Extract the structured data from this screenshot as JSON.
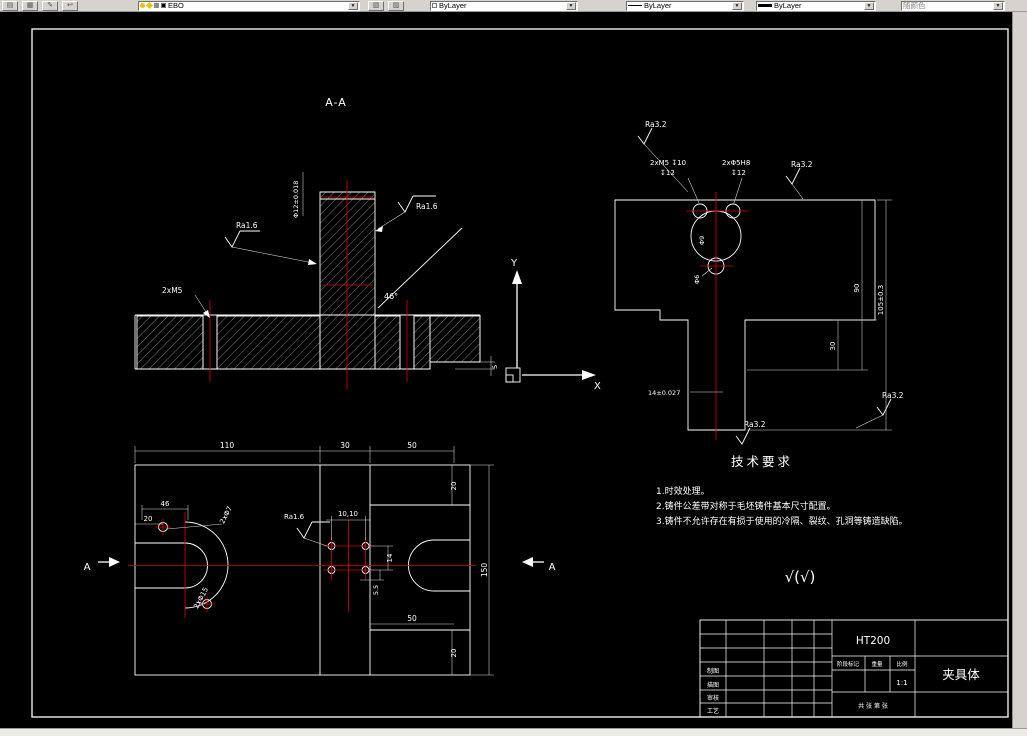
{
  "toolbar": {
    "layer": {
      "value": "EBO"
    },
    "color": {
      "value": "ByLayer"
    },
    "linetype": {
      "value": "ByLayer"
    },
    "lineweight": {
      "value": "ByLayer"
    },
    "plot_style": {
      "value": "随颜色"
    }
  },
  "palette": {
    "canvas_bg": "#000000",
    "drawing_line": "#ffffff",
    "centerline": "#dd0000",
    "toolbar_bg": "#d6d3ce"
  },
  "ucs": {
    "x": "X",
    "y": "Y"
  },
  "section_view": {
    "title": "A-A",
    "ra_right": "Ra1.6",
    "ra_left": "Ra1.6",
    "thread_label": "2xM5",
    "bore_label": "Φ12±0.018",
    "angle_label": "46°",
    "step_label": "5"
  },
  "right_view": {
    "ra_top": "Ra3.2",
    "ra_upper": "Ra3.2",
    "ra_lower_right": "Ra3.2",
    "ra_bottom": "Ra3.2",
    "thread_note_1": "2xM5 ↧10",
    "thread_note_2": "↧12",
    "hole_note_1": "2xΦ5H8",
    "hole_note_2": "↧12",
    "dia_label_1": "Φ9",
    "dia_label_2": "Φ6",
    "dim_30": "30",
    "dim_90": "90",
    "dim_105": "105±0.3",
    "dim_14": "14±0.027"
  },
  "plan_view": {
    "dim_110": "110",
    "dim_30": "30",
    "dim_50_top": "50",
    "dim_46": "46",
    "dim_20_left": "20",
    "holes_7": "2xΦ7",
    "holes_15": "2xΦ15",
    "ra": "Ra1.6",
    "dim_10_10": "10,10",
    "dim_14": "14",
    "dim_5_5": "5.5",
    "dim_50_bottom": "50",
    "dim_20_top_right": "20",
    "dim_20_bottom_right": "20",
    "dim_150": "150",
    "section_mark_left": "A",
    "section_mark_right": "A"
  },
  "tech_req": {
    "title": "技术要求",
    "items": [
      "1.时效处理。",
      "2.铸件公差带对称于毛坯铸件基本尺寸配置。",
      "3.铸件不允许存在有损于使用的冷隔、裂纹、孔洞等铸造缺陷。"
    ]
  },
  "finish_note": "√(√)",
  "title_block": {
    "material": "HT200",
    "part_name": "夹具体",
    "stage_label": "阶段标记",
    "weight_label": "重量",
    "scale_label": "比例",
    "scale_value": "1:1",
    "sheet_info": "共 张 第 张",
    "rows": [
      "制图",
      "描图",
      "审核",
      "工艺"
    ]
  }
}
